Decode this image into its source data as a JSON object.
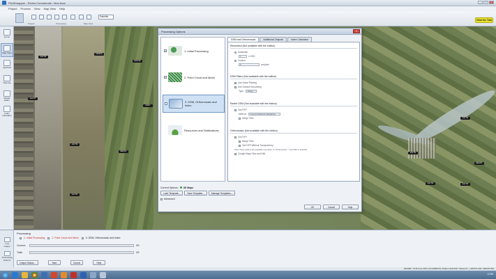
{
  "window": {
    "title": "Pix4Dmapper - Rivers Commercial - Mon Aval",
    "minimize": "_",
    "maximize": "□",
    "close": "x"
  },
  "menu": [
    "Project",
    "Process",
    "View",
    "Map View",
    "Help"
  ],
  "ribbon": {
    "layer_combo": "Satellite",
    "groups": [
      "Project",
      "Processing",
      "Map View"
    ],
    "cta": "Click for Trial"
  },
  "sidebar": {
    "items": [
      {
        "label": "Home",
        "icon": "home-icon"
      },
      {
        "label": "Map View",
        "icon": "map-icon"
      },
      {
        "label": "rayCloud",
        "icon": "raycloud-icon"
      },
      {
        "label": "Volumes",
        "icon": "volumes-icon"
      },
      {
        "label": "Mosaic Editor",
        "icon": "mosaic-icon"
      },
      {
        "label": "Index Calculator",
        "icon": "index-icon"
      }
    ]
  },
  "map_labels": [
    "2nd TR",
    "ROUTE",
    "CROPS",
    "2nd TR",
    "HOLT",
    "2nd TR",
    "ERAST",
    "2nd TR",
    "2nd TR",
    "2nd TR",
    "2nd TR",
    "ERAST",
    "2nd TR",
    "2nd TR"
  ],
  "dialog": {
    "title": "Processing Options",
    "close": "x",
    "steps": [
      {
        "label": "1. Initial Processing",
        "checked": true
      },
      {
        "label": "2. Point Cloud and Mesh",
        "checked": true
      },
      {
        "label": "3. DSM, Orthomosaic and Index",
        "checked": false
      },
      {
        "label": "Resources and Notifications",
        "checked": false
      }
    ],
    "tabs": [
      "DSM and Orthomosaic",
      "Additional Outputs",
      "Index Calculator"
    ],
    "resolution": {
      "title": "Resolution (Not available with the edition)",
      "automatic": "Automatic",
      "auto_value": "1",
      "auto_unit": "x GSD",
      "custom": "Custom",
      "custom_value": "5",
      "custom_unit": "cm/pixel"
    },
    "dsm_filters": {
      "title": "DSM Filters (Not available with the edition)",
      "noise": "Use Noise Filtering",
      "smoothing": "Use Surface Smoothing",
      "type_label": "Type:",
      "type_value": "Sharp"
    },
    "raster_dsm": {
      "title": "Raster DSM (Not available with the edition)",
      "geotiff": "GeoTIFF",
      "method_label": "Method:",
      "method_value": "Inverse Distance Weighting",
      "merge": "Merge Tiles"
    },
    "ortho": {
      "title": "Orthomosaic (Not available with the edition)",
      "geotiff": "GeoTIFF",
      "merge": "Merge Tiles",
      "transparency": "GeoTIFF Without Transparency",
      "note": "Note: these options are available only when \"3. Orthomosaic\" > GeoTIFF is selected",
      "kml": "Google Maps Tiles and KML"
    },
    "current_options_label": "Current Options:",
    "current_options_value": "3D Maps",
    "template_buttons": [
      "Load Template...",
      "Save Template...",
      "Manage Templates..."
    ],
    "advanced": "Advanced",
    "ok": "OK",
    "cancel": "Cancel",
    "help": "Help"
  },
  "processing": {
    "title": "Processing",
    "steps": [
      "1. Initial Processing",
      "2. Point Cloud and Mesh",
      "3. DSM, Orthomosaic and Index"
    ],
    "current_label": "Current:",
    "current_pct": "0%",
    "total_label": "Total:",
    "total_value": "0/3",
    "current_progress": 0,
    "total_progress": 0,
    "buttons": [
      "Output Status...",
      "Start",
      "Cancel",
      "Help"
    ]
  },
  "proc_side": [
    {
      "label": "Log Output",
      "icon": "log-icon"
    },
    {
      "label": "Processing Options",
      "icon": "processing-icon"
    }
  ],
  "status": {
    "coords": "WGS84 / UTM zone 35N | 23.91868743; Pollenz ENU230 / Stereo70 - | 395741.393, 490233.599"
  },
  "taskbar": {
    "clock": "11:59"
  }
}
